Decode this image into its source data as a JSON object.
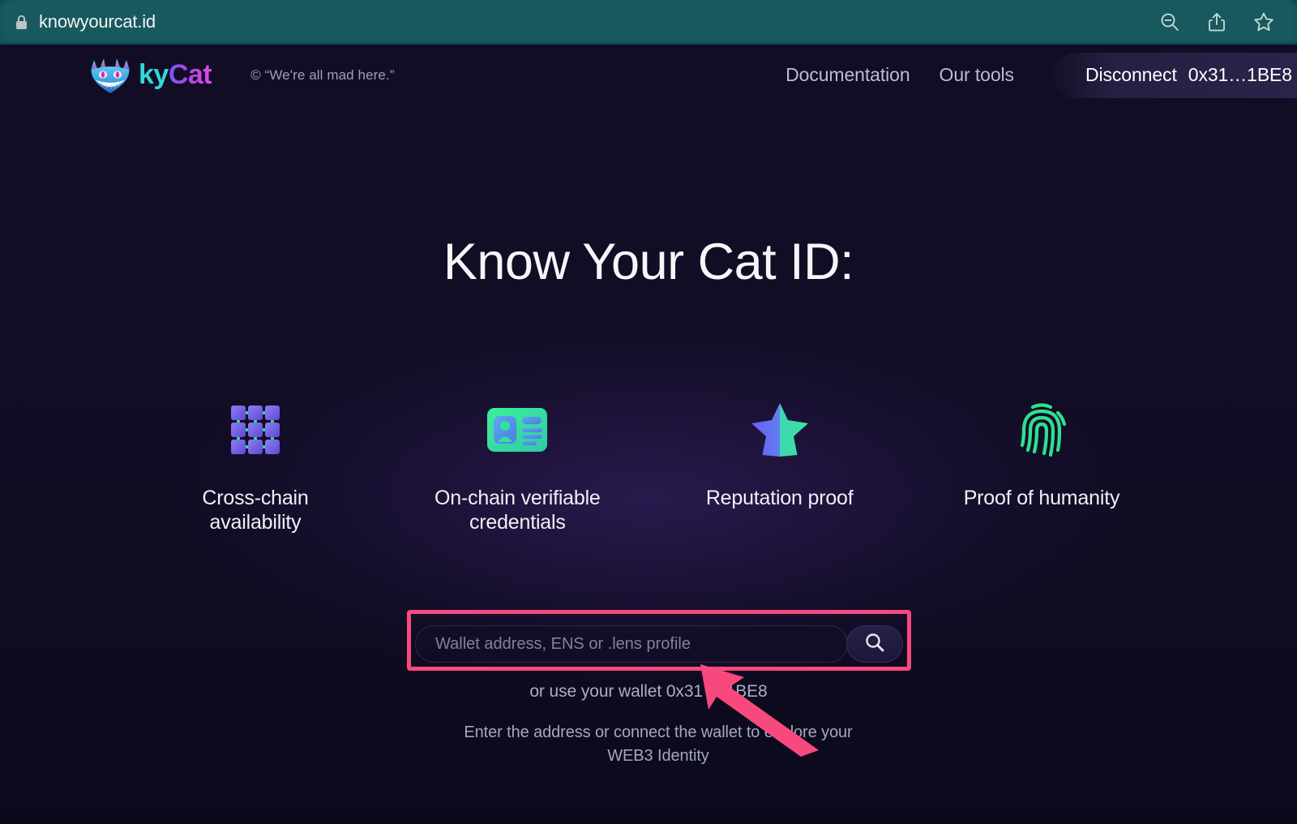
{
  "browser": {
    "url": "knowyourcat.id",
    "lock_icon": "lock-icon",
    "actions": [
      {
        "name": "zoom-out-icon",
        "label": "Zoom out"
      },
      {
        "name": "share-icon",
        "label": "Share"
      },
      {
        "name": "bookmark-star-icon",
        "label": "Bookmark"
      }
    ],
    "chrome_color": "#18595f"
  },
  "header": {
    "logo_icon": "cheshire-cat-logo-icon",
    "brand_ky": "ky",
    "brand_cat": "Cat",
    "tagline": "© “We're all mad here.”",
    "nav": [
      {
        "label": "Documentation"
      },
      {
        "label": "Our tools"
      }
    ],
    "wallet_button": {
      "action": "Disconnect",
      "address": "0x31…1BE8"
    }
  },
  "hero": {
    "title": "Know Your Cat ID:"
  },
  "features": [
    {
      "icon": "cross-chain-grid-icon",
      "label": "Cross-chain availability"
    },
    {
      "icon": "id-card-icon",
      "label": "On-chain verifiable credentials"
    },
    {
      "icon": "star-icon",
      "label": "Reputation proof"
    },
    {
      "icon": "fingerprint-icon",
      "label": "Proof of humanity"
    }
  ],
  "search": {
    "placeholder": "Wallet address, ENS or .lens profile",
    "value": "",
    "button_icon": "search-icon",
    "highlight_color": "#f8497e"
  },
  "hints": {
    "wallet_hint": "or use your wallet 0x31 ... 1BE8",
    "sub_hint": "Enter the address or connect the wallet to explore your WEB3 Identity"
  },
  "annotation": {
    "arrow_icon": "pointer-arrow-icon",
    "arrow_color": "#f8497e"
  },
  "colors": {
    "background": "#120d25",
    "accent_cyan": "#2fd9da",
    "accent_magenta": "#d84ee0",
    "accent_green": "#33e08a"
  }
}
